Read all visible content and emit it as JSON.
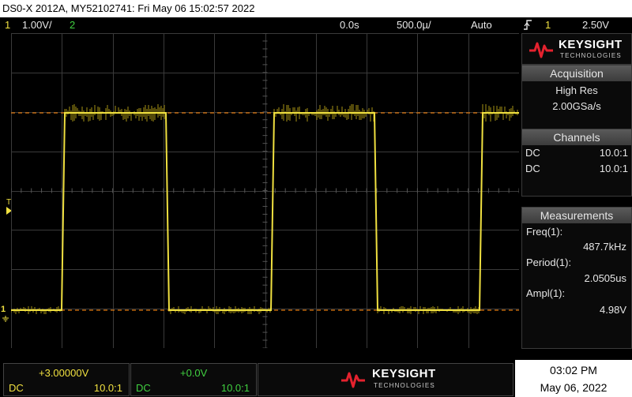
{
  "window": {
    "title": "DS0-X 2012A, MY52102741: Fri May 06 15:02:57 2022"
  },
  "top_status": {
    "ch1_number": "1",
    "ch1_scale": "1.00V/",
    "ch2_number": "2",
    "time_offset": "0.0s",
    "time_scale": "500.0µ/",
    "trigger_mode": "Auto",
    "trigger_icon": "rising-edge-icon",
    "trigger_channel": "1",
    "trigger_level": "2.50V"
  },
  "colors": {
    "ch1": "#f0e040",
    "ch2": "#40d040",
    "grid": "#3a3a3a",
    "threshold": "#e07a10",
    "keysight_red": "#e4222e"
  },
  "right_panel": {
    "brand": "KEYSIGHT",
    "brand_sub": "TECHNOLOGIES",
    "acquisition": {
      "header": "Acquisition",
      "mode": "High Res",
      "rate": "2.00GSa/s"
    },
    "channels": {
      "header": "Channels",
      "items": [
        {
          "coupling": "DC",
          "probe": "10.0:1"
        },
        {
          "coupling": "DC",
          "probe": "10.0:1"
        }
      ]
    },
    "measurements": {
      "header": "Measurements",
      "items": [
        {
          "label": "Freq(1):",
          "value": "487.7kHz"
        },
        {
          "label": "Period(1):",
          "value": "2.0505us"
        },
        {
          "label": "Ampl(1):",
          "value": "4.98V"
        }
      ]
    }
  },
  "screen_markers": {
    "trigger_marker": "T",
    "ground_marker": "1"
  },
  "bottom_bar": {
    "ch1": {
      "offset": "+3.00000V",
      "coupling": "DC",
      "probe": "10.0:1"
    },
    "ch2": {
      "offset": "+0.0V",
      "coupling": "DC",
      "probe": "10.0:1"
    },
    "brand": "KEYSIGHT",
    "brand_sub": "TECHNOLOGIES",
    "time": "03:02 PM",
    "date": "May 06, 2022"
  }
}
